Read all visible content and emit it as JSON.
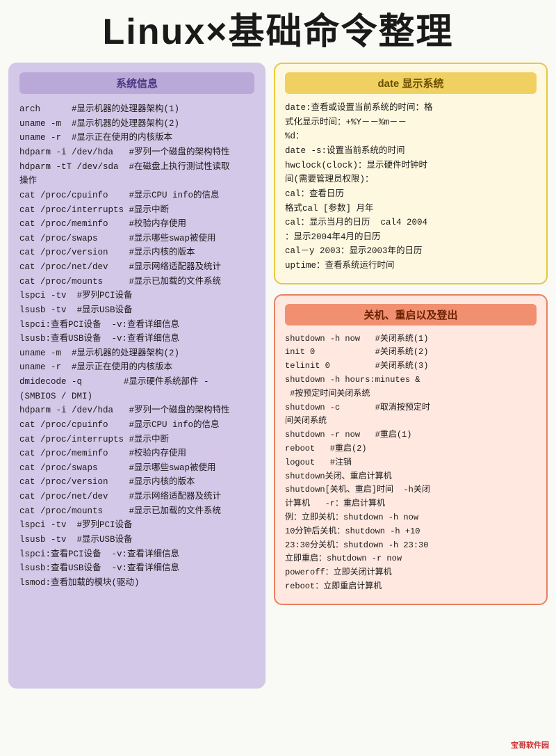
{
  "page": {
    "title": "Linux×基础命令整理",
    "watermark": "宝哥软件园"
  },
  "left_panel": {
    "title": "系统信息",
    "content": "arch      #显示机器的处理器架构(1)\nuname -m  #显示机器的处理器架构(2)\nuname -r  #显示正在使用的内核版本\nhdparm -i /dev/hda   #罗列一个磁盘的架构特性\nhdparm -tT /dev/sda  #在磁盘上执行测试性读取\n操作\ncat /proc/cpuinfo    #显示CPU info的信息\ncat /proc/interrupts #显示中断\ncat /proc/meminfo    #校验内存使用\ncat /proc/swaps      #显示哪些swap被使用\ncat /proc/version    #显示内核的版本\ncat /proc/net/dev    #显示网络适配器及统计\ncat /proc/mounts     #显示已加载的文件系统\nlspci -tv  #罗列PCI设备\nlsusb -tv  #显示USB设备\nlspci:查看PCI设备  -v:查看详细信息\nlsusb:查看USB设备  -v:查看详细信息\nuname -m  #显示机器的处理器架构(2)\nuname -r  #显示正在使用的内核版本\ndmidecode -q        #显示硬件系统部件 -\n(SMBIOS / DMI)\nhdparm -i /dev/hda   #罗列一个磁盘的架构特性\ncat /proc/cpuinfo    #显示CPU info的信息\ncat /proc/interrupts #显示中断\ncat /proc/meminfo    #校验内存使用\ncat /proc/swaps      #显示哪些swap被使用\ncat /proc/version    #显示内核的版本\ncat /proc/net/dev    #显示网络适配器及统计\ncat /proc/mounts     #显示已加载的文件系统\nlspci -tv  #罗列PCI设备\nlsusb -tv  #显示USB设备\nlspci:查看PCI设备  -v:查看详细信息\nlsusb:查看USB设备  -v:查看详细信息\nlsmod:查看加载的模块(驱动)"
  },
  "date_panel": {
    "title": "date 显示系统",
    "content": "date:查看或设置当前系统的时间：格\n式化显示时间：+%Y－－%m－－\n%d：\ndate -s:设置当前系统的时间\nhwclock(clock)：显示硬件时钟时\n间(需要管理员权限)：\ncal：查看日历\n格式cal [参数] 月年\ncal：显示当月的日历  cal4 2004\n：显示2004年4月的日历\ncal－y 2003：显示2003年的日历\nuptime：查看系统运行时间"
  },
  "shutdown_panel": {
    "title": "关机、重启以及登出",
    "content": "shutdown -h now   #关闭系统(1)\ninit 0            #关闭系统(2)\ntelinit 0         #关闭系统(3)\nshutdown -h hours:minutes &\n #按预定时间关闭系统\nshutdown -c       #取消按预定时\n间关闭系统\nshutdown -r now   #重启(1)\nreboot   #重启(2)\nlogout   #注销\nshutdown关闭、重启计算机\nshutdown[关机、重启]时间  -h关闭\n计算机   -r：重启计算机\n例：立即关机：shutdown -h now\n10分钟后关机：shutdown -h +10\n23:30分关机：shutdown -h 23:30\n立即重启：shutdown -r now\npoweroff：立即关闭计算机\nreboot：立即重启计算机"
  }
}
